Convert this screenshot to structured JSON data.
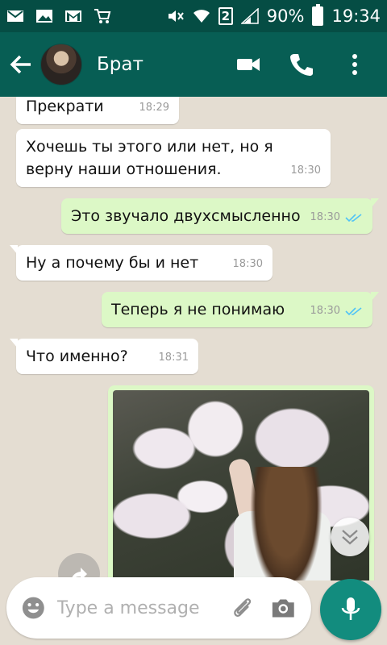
{
  "status_bar": {
    "sim_slot": "2",
    "battery": "90%",
    "time": "19:34"
  },
  "header": {
    "contact_name": "Брат"
  },
  "messages": [
    {
      "direction": "in",
      "text": "Прекрати",
      "time": "18:29"
    },
    {
      "direction": "in",
      "text_line1": "Хочешь ты этого или нет, но я",
      "text_line2": "верну наши отношения.",
      "time": "18:30"
    },
    {
      "direction": "out",
      "text": "Это звучало двухсмысленно",
      "time": "18:30"
    },
    {
      "direction": "in",
      "text": "Ну а почему бы и нет",
      "time": "18:30"
    },
    {
      "direction": "out",
      "text": "Теперь я не понимаю",
      "time": "18:30"
    },
    {
      "direction": "in",
      "text": "Что именно?",
      "time": "18:31"
    }
  ],
  "composer": {
    "placeholder": "Type a message"
  },
  "colors": {
    "status_bar": "#054d44",
    "app_bar": "#075e54",
    "outgoing_bubble": "#dcf8c6",
    "incoming_bubble": "#ffffff",
    "mic_button": "#128c7e",
    "read_ticks": "#4fc3f7"
  },
  "icons": {
    "status_left": [
      "mail-icon",
      "image-icon",
      "gmail-icon",
      "cart-icon"
    ],
    "status_right": [
      "mute-icon",
      "wifi-icon",
      "signal-icon",
      "battery-icon"
    ],
    "header_actions": [
      "video-call-icon",
      "phone-icon",
      "more-vert-icon"
    ]
  }
}
